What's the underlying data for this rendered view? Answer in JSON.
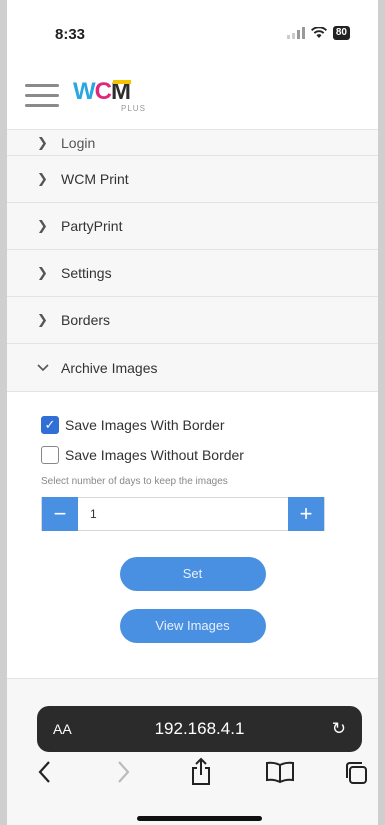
{
  "status_bar": {
    "time": "8:33",
    "battery": "80"
  },
  "header": {
    "logo_text": "WCM",
    "logo_sub": "PLUS"
  },
  "menu": {
    "items": [
      {
        "label": "Login",
        "state": "collapsed"
      },
      {
        "label": "WCM Print",
        "state": "collapsed"
      },
      {
        "label": "PartyPrint",
        "state": "collapsed"
      },
      {
        "label": "Settings",
        "state": "collapsed"
      },
      {
        "label": "Borders",
        "state": "collapsed"
      },
      {
        "label": "Archive Images",
        "state": "expanded"
      }
    ]
  },
  "archive_panel": {
    "options": [
      {
        "label": "Save Images With Border",
        "checked": true
      },
      {
        "label": "Save Images Without Border",
        "checked": false
      }
    ],
    "hint": "Select number of days to keep the images",
    "days_value": "1",
    "set_label": "Set",
    "view_label": "View Images"
  },
  "browser": {
    "aa_label": "AA",
    "url": "192.168.4.1"
  },
  "colors": {
    "accent_blue": "#4a90e2",
    "checkbox_blue": "#2f6fd6"
  }
}
